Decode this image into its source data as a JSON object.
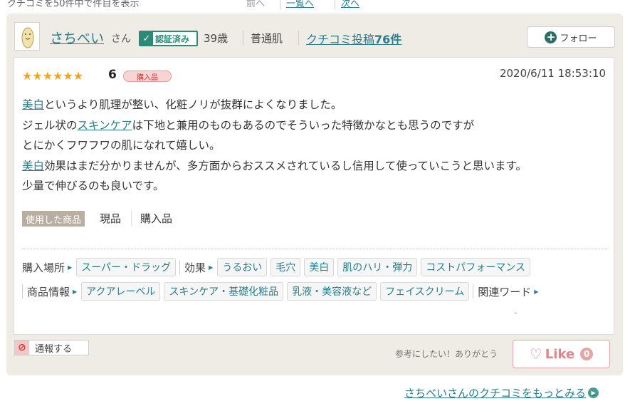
{
  "top_strip": {
    "left_text": "クチコミを50件中で件目を表示",
    "mid_text": "前へ",
    "link1": "一覧へ",
    "link2": "次へ"
  },
  "review": {
    "user_name": "さちべい",
    "honorific": "さん",
    "verified_label": "認証済み",
    "age": "39歳",
    "skin_type": "普通肌",
    "review_count_prefix": "クチコミ投稿",
    "review_count_value": "76件",
    "follow_label": "フォロー",
    "rating": "6",
    "stars_icon": "★★★★★★",
    "purchase_badge": "購入品",
    "date": "2020/6/11 18:53:10",
    "body": {
      "l1_link": "美白",
      "l1_rest": "というより肌理が整い、化粧ノリが抜群によくなりました。",
      "l2_a": "ジェル状の",
      "l2_link": "スキンケア",
      "l2_b": "は下地と兼用のものもあるのでそういった特徴かなとも思うのですが",
      "l3": "とにかくフワフワの肌になれて嬉しい。",
      "l4_link": "美白",
      "l4_rest": "効果はまだ分かりませんが、多方面からおススメされているし信用して使っていこうと思います。",
      "l5": "少量で伸びるのも良いです。"
    },
    "used_label": "使用した商品",
    "used_value1": "現品",
    "used_value2": "購入品",
    "tags": {
      "purchase_place_label": "購入場所",
      "purchase_place": [
        "スーパー・ドラッグ"
      ],
      "effect_label": "効果",
      "effects": [
        "うるおい",
        "毛穴",
        "美白",
        "肌のハリ・弾力",
        "コストパフォーマンス"
      ],
      "product_info_label": "商品情報",
      "product_info": [
        "アクアレーベル",
        "スキンケア・基礎化粧品",
        "乳液・美容液など",
        "フェイスクリーム"
      ],
      "related_label": "関連ワード",
      "related_value": "-"
    },
    "report_label": "通報する",
    "thanks_text": "参考にしたい！ありがとう",
    "like_label": "Like",
    "like_count": "0",
    "more_link": "さちべいさんのクチコミをもっとみる"
  },
  "colors": {
    "accent": "#2a7d8c",
    "verified": "#2a8a76",
    "star": "#f4a31d",
    "like": "#e4838a",
    "card_bg": "#efebe5"
  }
}
